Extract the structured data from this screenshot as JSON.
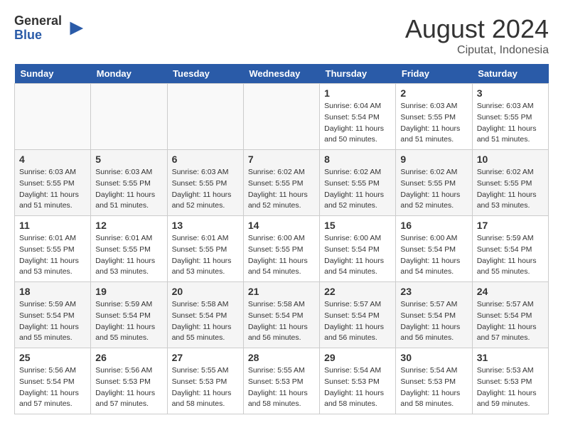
{
  "logo": {
    "general": "General",
    "blue": "Blue"
  },
  "title": {
    "month_year": "August 2024",
    "location": "Ciputat, Indonesia"
  },
  "days_of_week": [
    "Sunday",
    "Monday",
    "Tuesday",
    "Wednesday",
    "Thursday",
    "Friday",
    "Saturday"
  ],
  "weeks": [
    [
      {
        "day": "",
        "info": ""
      },
      {
        "day": "",
        "info": ""
      },
      {
        "day": "",
        "info": ""
      },
      {
        "day": "",
        "info": ""
      },
      {
        "day": "1",
        "info": "Sunrise: 6:04 AM\nSunset: 5:54 PM\nDaylight: 11 hours\nand 50 minutes."
      },
      {
        "day": "2",
        "info": "Sunrise: 6:03 AM\nSunset: 5:55 PM\nDaylight: 11 hours\nand 51 minutes."
      },
      {
        "day": "3",
        "info": "Sunrise: 6:03 AM\nSunset: 5:55 PM\nDaylight: 11 hours\nand 51 minutes."
      }
    ],
    [
      {
        "day": "4",
        "info": "Sunrise: 6:03 AM\nSunset: 5:55 PM\nDaylight: 11 hours\nand 51 minutes."
      },
      {
        "day": "5",
        "info": "Sunrise: 6:03 AM\nSunset: 5:55 PM\nDaylight: 11 hours\nand 51 minutes."
      },
      {
        "day": "6",
        "info": "Sunrise: 6:03 AM\nSunset: 5:55 PM\nDaylight: 11 hours\nand 52 minutes."
      },
      {
        "day": "7",
        "info": "Sunrise: 6:02 AM\nSunset: 5:55 PM\nDaylight: 11 hours\nand 52 minutes."
      },
      {
        "day": "8",
        "info": "Sunrise: 6:02 AM\nSunset: 5:55 PM\nDaylight: 11 hours\nand 52 minutes."
      },
      {
        "day": "9",
        "info": "Sunrise: 6:02 AM\nSunset: 5:55 PM\nDaylight: 11 hours\nand 52 minutes."
      },
      {
        "day": "10",
        "info": "Sunrise: 6:02 AM\nSunset: 5:55 PM\nDaylight: 11 hours\nand 53 minutes."
      }
    ],
    [
      {
        "day": "11",
        "info": "Sunrise: 6:01 AM\nSunset: 5:55 PM\nDaylight: 11 hours\nand 53 minutes."
      },
      {
        "day": "12",
        "info": "Sunrise: 6:01 AM\nSunset: 5:55 PM\nDaylight: 11 hours\nand 53 minutes."
      },
      {
        "day": "13",
        "info": "Sunrise: 6:01 AM\nSunset: 5:55 PM\nDaylight: 11 hours\nand 53 minutes."
      },
      {
        "day": "14",
        "info": "Sunrise: 6:00 AM\nSunset: 5:55 PM\nDaylight: 11 hours\nand 54 minutes."
      },
      {
        "day": "15",
        "info": "Sunrise: 6:00 AM\nSunset: 5:54 PM\nDaylight: 11 hours\nand 54 minutes."
      },
      {
        "day": "16",
        "info": "Sunrise: 6:00 AM\nSunset: 5:54 PM\nDaylight: 11 hours\nand 54 minutes."
      },
      {
        "day": "17",
        "info": "Sunrise: 5:59 AM\nSunset: 5:54 PM\nDaylight: 11 hours\nand 55 minutes."
      }
    ],
    [
      {
        "day": "18",
        "info": "Sunrise: 5:59 AM\nSunset: 5:54 PM\nDaylight: 11 hours\nand 55 minutes."
      },
      {
        "day": "19",
        "info": "Sunrise: 5:59 AM\nSunset: 5:54 PM\nDaylight: 11 hours\nand 55 minutes."
      },
      {
        "day": "20",
        "info": "Sunrise: 5:58 AM\nSunset: 5:54 PM\nDaylight: 11 hours\nand 55 minutes."
      },
      {
        "day": "21",
        "info": "Sunrise: 5:58 AM\nSunset: 5:54 PM\nDaylight: 11 hours\nand 56 minutes."
      },
      {
        "day": "22",
        "info": "Sunrise: 5:57 AM\nSunset: 5:54 PM\nDaylight: 11 hours\nand 56 minutes."
      },
      {
        "day": "23",
        "info": "Sunrise: 5:57 AM\nSunset: 5:54 PM\nDaylight: 11 hours\nand 56 minutes."
      },
      {
        "day": "24",
        "info": "Sunrise: 5:57 AM\nSunset: 5:54 PM\nDaylight: 11 hours\nand 57 minutes."
      }
    ],
    [
      {
        "day": "25",
        "info": "Sunrise: 5:56 AM\nSunset: 5:54 PM\nDaylight: 11 hours\nand 57 minutes."
      },
      {
        "day": "26",
        "info": "Sunrise: 5:56 AM\nSunset: 5:53 PM\nDaylight: 11 hours\nand 57 minutes."
      },
      {
        "day": "27",
        "info": "Sunrise: 5:55 AM\nSunset: 5:53 PM\nDaylight: 11 hours\nand 58 minutes."
      },
      {
        "day": "28",
        "info": "Sunrise: 5:55 AM\nSunset: 5:53 PM\nDaylight: 11 hours\nand 58 minutes."
      },
      {
        "day": "29",
        "info": "Sunrise: 5:54 AM\nSunset: 5:53 PM\nDaylight: 11 hours\nand 58 minutes."
      },
      {
        "day": "30",
        "info": "Sunrise: 5:54 AM\nSunset: 5:53 PM\nDaylight: 11 hours\nand 58 minutes."
      },
      {
        "day": "31",
        "info": "Sunrise: 5:53 AM\nSunset: 5:53 PM\nDaylight: 11 hours\nand 59 minutes."
      }
    ]
  ]
}
